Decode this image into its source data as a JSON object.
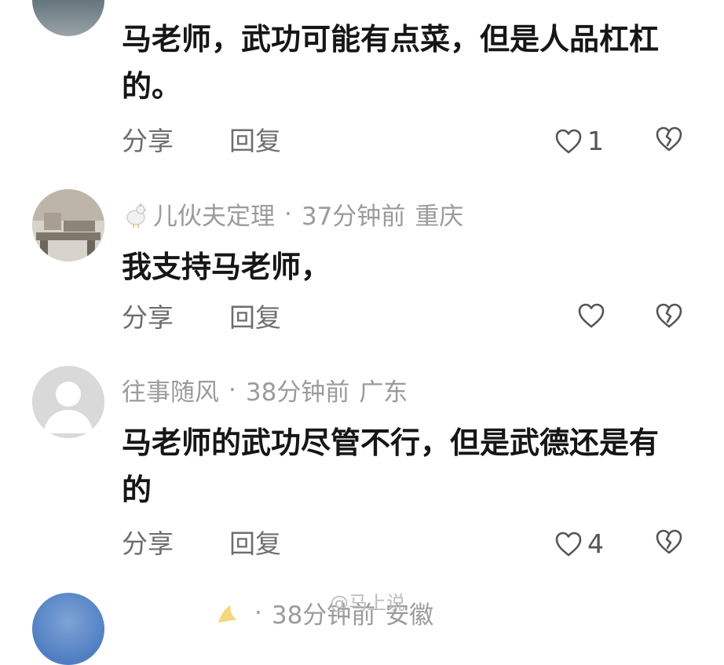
{
  "comments": [
    {
      "username": "",
      "time": "",
      "location": "",
      "text": "马老师，武功可能有点菜，但是人品杠杠的。",
      "share_label": "分享",
      "reply_label": "回复",
      "like_count": "1"
    },
    {
      "username": "儿伙夫定理",
      "time": "37分钟前",
      "location": "重庆",
      "separator": "·",
      "text": "我支持马老师，",
      "share_label": "分享",
      "reply_label": "回复",
      "like_count": ""
    },
    {
      "username": "往事随风",
      "time": "38分钟前",
      "location": "广东",
      "separator": "·",
      "text": "马老师的武功尽管不行，但是武德还是有的",
      "share_label": "分享",
      "reply_label": "回复",
      "like_count": "4"
    },
    {
      "username": "",
      "time": "38分钟前",
      "location": "安徽",
      "separator": "·"
    }
  ],
  "watermark": "@马上说",
  "icons": {
    "like": "heart-outline-icon",
    "dislike": "broken-heart-icon",
    "badge": "chicken-icon"
  },
  "colors": {
    "text": "#161616",
    "meta": "#9b9b9b",
    "action": "#6e6e6e"
  }
}
